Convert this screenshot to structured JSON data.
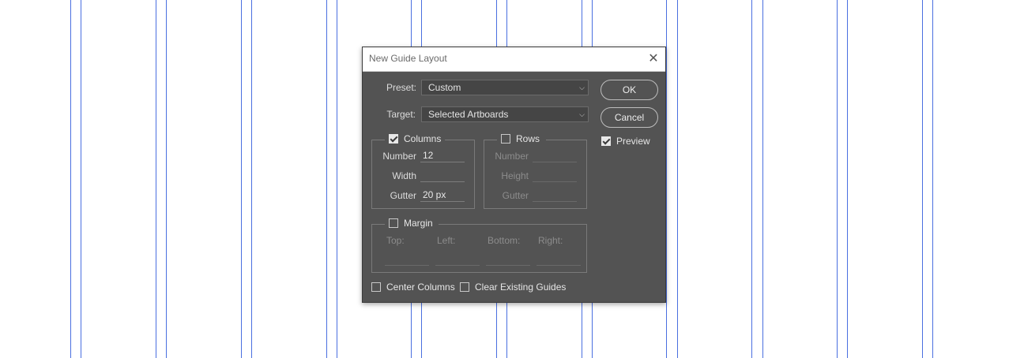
{
  "dialog": {
    "title": "New Guide Layout",
    "close_glyph": "✕",
    "preset": {
      "label": "Preset:",
      "value": "Custom"
    },
    "target": {
      "label": "Target:",
      "value": "Selected Artboards"
    },
    "columns": {
      "label": "Columns",
      "checked": true,
      "number_label": "Number",
      "number_value": "12",
      "width_label": "Width",
      "width_value": "",
      "gutter_label": "Gutter",
      "gutter_value": "20 px"
    },
    "rows": {
      "label": "Rows",
      "checked": false,
      "number_label": "Number",
      "height_label": "Height",
      "gutter_label": "Gutter"
    },
    "margin": {
      "label": "Margin",
      "checked": false,
      "top_label": "Top:",
      "left_label": "Left:",
      "bottom_label": "Bottom:",
      "right_label": "Right:"
    },
    "center_columns": {
      "label": "Center Columns",
      "checked": false
    },
    "clear_guides": {
      "label": "Clear Existing Guides",
      "checked": false
    },
    "ok_label": "OK",
    "cancel_label": "Cancel",
    "preview": {
      "label": "Preview",
      "checked": true
    }
  },
  "colors": {
    "guide": "#4a6fe0",
    "dialog_bg": "#535353",
    "titlebar_bg": "#ffffff"
  }
}
